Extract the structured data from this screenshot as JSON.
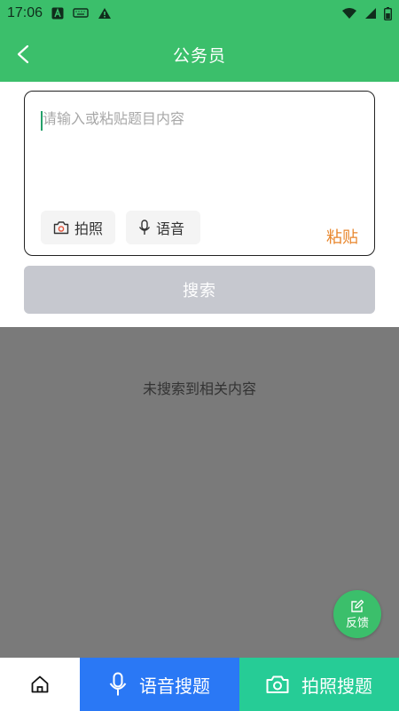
{
  "status_bar": {
    "time": "17:06",
    "icons_left": [
      "a-icon",
      "keyboard-icon",
      "warning-icon"
    ],
    "icons_right": [
      "wifi-icon",
      "signal-icon",
      "battery-icon"
    ]
  },
  "header": {
    "title": "公务员",
    "back_icon": "chevron-left-icon",
    "bg_color": "#3bbf6b"
  },
  "search_panel": {
    "input_value": "",
    "input_placeholder": "请输入或粘贴题目内容",
    "photo_chip_label": "拍照",
    "voice_chip_label": "语音",
    "paste_label": "粘贴",
    "search_button_label": "搜索",
    "paste_color": "#e8862c"
  },
  "results": {
    "empty_text": "未搜索到相关内容"
  },
  "feedback": {
    "label": "反馈"
  },
  "bottom_bar": {
    "home_icon": "home-icon",
    "voice_label": "语音搜题",
    "photo_label": "拍照搜题",
    "voice_color": "#2a78f5",
    "photo_color": "#26cc96"
  }
}
